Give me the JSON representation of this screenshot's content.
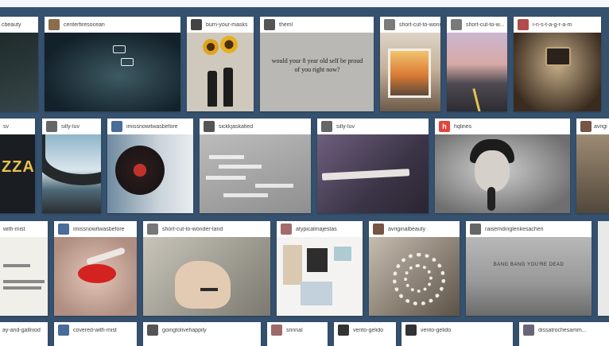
{
  "row1": [
    {
      "user": "cbeauty"
    },
    {
      "user": "centerfiresocean"
    },
    {
      "user": "burn-your-masks"
    },
    {
      "user": "theml"
    },
    {
      "user": "short-cut-to-wonder"
    },
    {
      "user": "short-cut-to-w..."
    },
    {
      "user": "i-n-s-t-a-g-r-a-m"
    }
  ],
  "row1_quote": "would your 8 year old self be proud of you right now?",
  "row2": [
    {
      "user": "sv"
    },
    {
      "user": "silly-luv"
    },
    {
      "user": "imissnowitwasbefore"
    },
    {
      "user": "sickkjaskafied"
    },
    {
      "user": "silly-luv"
    },
    {
      "user": "hqlines",
      "avatar_letter": "h"
    },
    {
      "user": "avrigi"
    }
  ],
  "row2_partial_text": "ZZA",
  "row3": [
    {
      "user": "with-mist"
    },
    {
      "user": "imissnowitwasbefore"
    },
    {
      "user": "short-cut-to-wonder-land"
    },
    {
      "user": "atypicalmajestas"
    },
    {
      "user": "avriginalbeauty"
    },
    {
      "user": "raisemdinglenkesachen"
    }
  ],
  "row3_sign": "BANG BANG YOU'RE DEAD",
  "row4": [
    {
      "user": "ay-and-gallniod"
    },
    {
      "user": "covered-with-mist"
    },
    {
      "user": "goingtolivehappily"
    },
    {
      "user": "srinnal"
    },
    {
      "user": "vento-gelido"
    },
    {
      "user": "vento-gelido"
    },
    {
      "user": "dissatrochesamm..."
    }
  ]
}
